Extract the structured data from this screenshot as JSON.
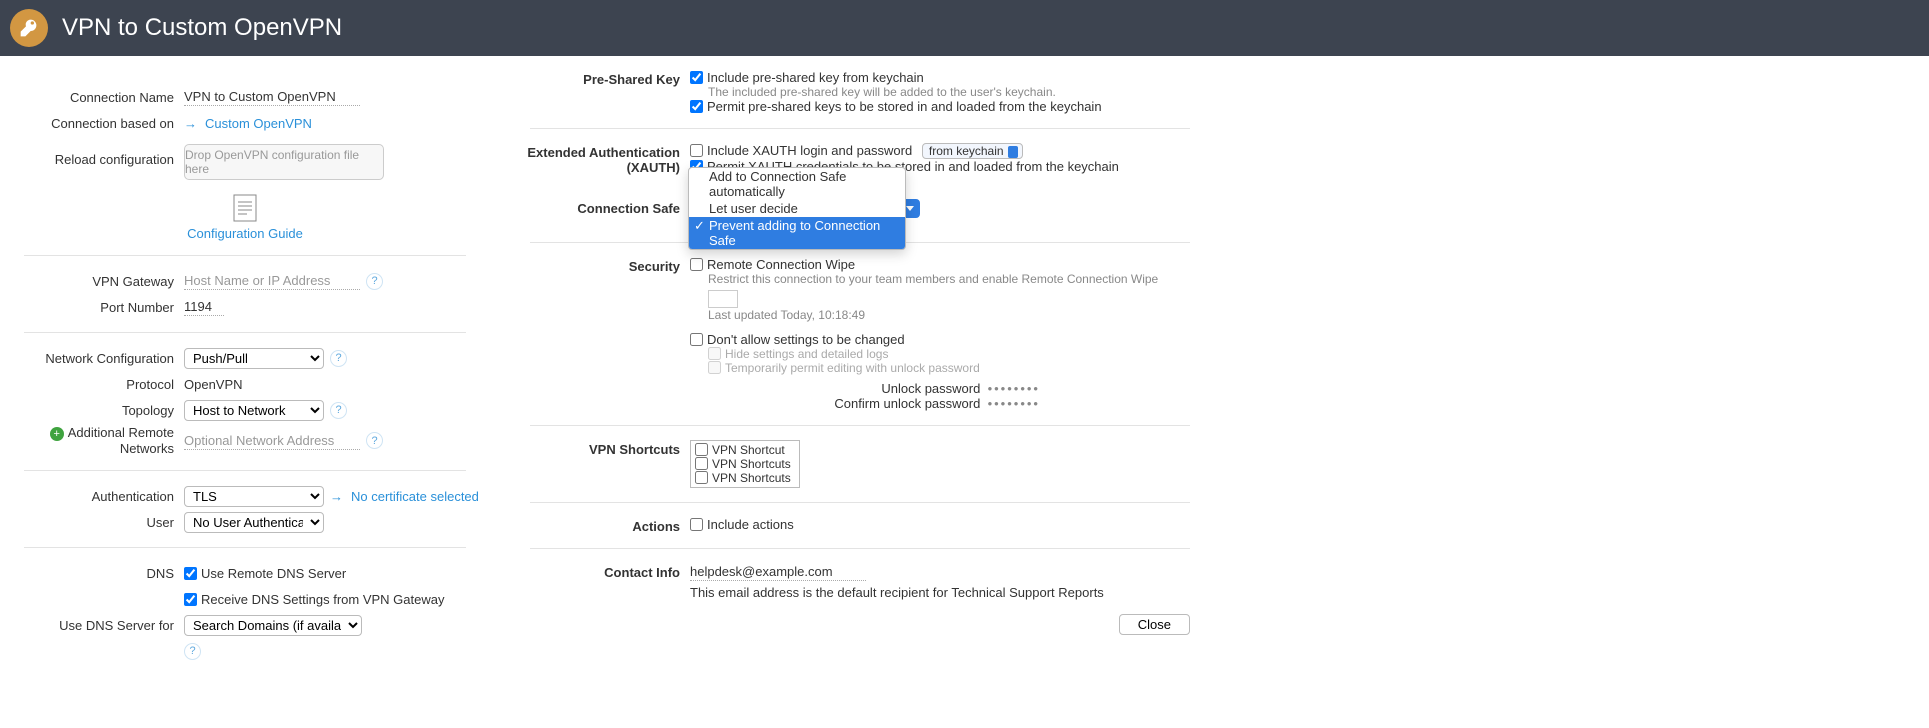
{
  "header": {
    "title": "VPN to Custom OpenVPN"
  },
  "left": {
    "connection_name_label": "Connection Name",
    "connection_name_value": "VPN to Custom OpenVPN",
    "based_on_label": "Connection based on",
    "based_on_link": "Custom OpenVPN",
    "reload_label": "Reload configuration",
    "dropzone_text": "Drop OpenVPN configuration file here",
    "config_guide": "Configuration Guide",
    "gateway_label": "VPN Gateway",
    "gateway_placeholder": "Host Name or IP Address",
    "port_label": "Port Number",
    "port_value": "1194",
    "netconf_label": "Network Configuration",
    "netconf_value": "Push/Pull",
    "protocol_label": "Protocol",
    "protocol_value": "OpenVPN",
    "topology_label": "Topology",
    "topology_value": "Host to Network",
    "add_remote_label": "Additional Remote Networks",
    "add_remote_placeholder": "Optional Network Address",
    "auth_label": "Authentication",
    "auth_value": "TLS",
    "no_cert": "No certificate selected",
    "user_label": "User",
    "user_value": "No User Authentication",
    "dns_label": "DNS",
    "dns_remote": "Use Remote DNS Server",
    "dns_receive": "Receive DNS Settings from VPN Gateway",
    "dns_for_label": "Use DNS Server for",
    "dns_for_value": "Search Domains (if available)"
  },
  "right": {
    "psk_label": "Pre-Shared Key",
    "psk_include": "Include pre-shared key from keychain",
    "psk_hint": "The included pre-shared key will be added to the user's keychain.",
    "psk_permit": "Permit pre-shared keys to be stored in and loaded from the keychain",
    "xauth_label": "Extended Authentication (XAUTH)",
    "xauth_include": "Include XAUTH login and password",
    "xauth_source": "from keychain",
    "xauth_permit": "Permit XAUTH credentials to be stored in and loaded from the keychain",
    "conn_safe_label": "Connection Safe",
    "conn_safe_options": [
      "Add to Connection Safe automatically",
      "Let user decide",
      "Prevent adding to Connection Safe"
    ],
    "conn_safe_selected": "Prevent adding to Connection Safe",
    "security_label": "Security",
    "remote_wipe": "Remote Connection Wipe",
    "remote_wipe_hint": "Restrict this connection to your team members and enable Remote Connection Wipe",
    "last_updated": "Last updated Today, 10:18:49",
    "dont_allow": "Don't allow settings to be changed",
    "hide_settings": "Hide settings and detailed logs",
    "temp_permit": "Temporarily permit editing with unlock password",
    "unlock_pw": "Unlock password",
    "confirm_pw": "Confirm unlock password",
    "shortcuts_label": "VPN Shortcuts",
    "shortcuts": [
      "VPN Shortcut",
      "VPN Shortcuts",
      "VPN Shortcuts"
    ],
    "actions_label": "Actions",
    "actions_include": "Include actions",
    "contact_label": "Contact Info",
    "contact_email": "helpdesk@example.com",
    "contact_hint": "This email address is the default recipient for Technical Support Reports",
    "close": "Close"
  }
}
